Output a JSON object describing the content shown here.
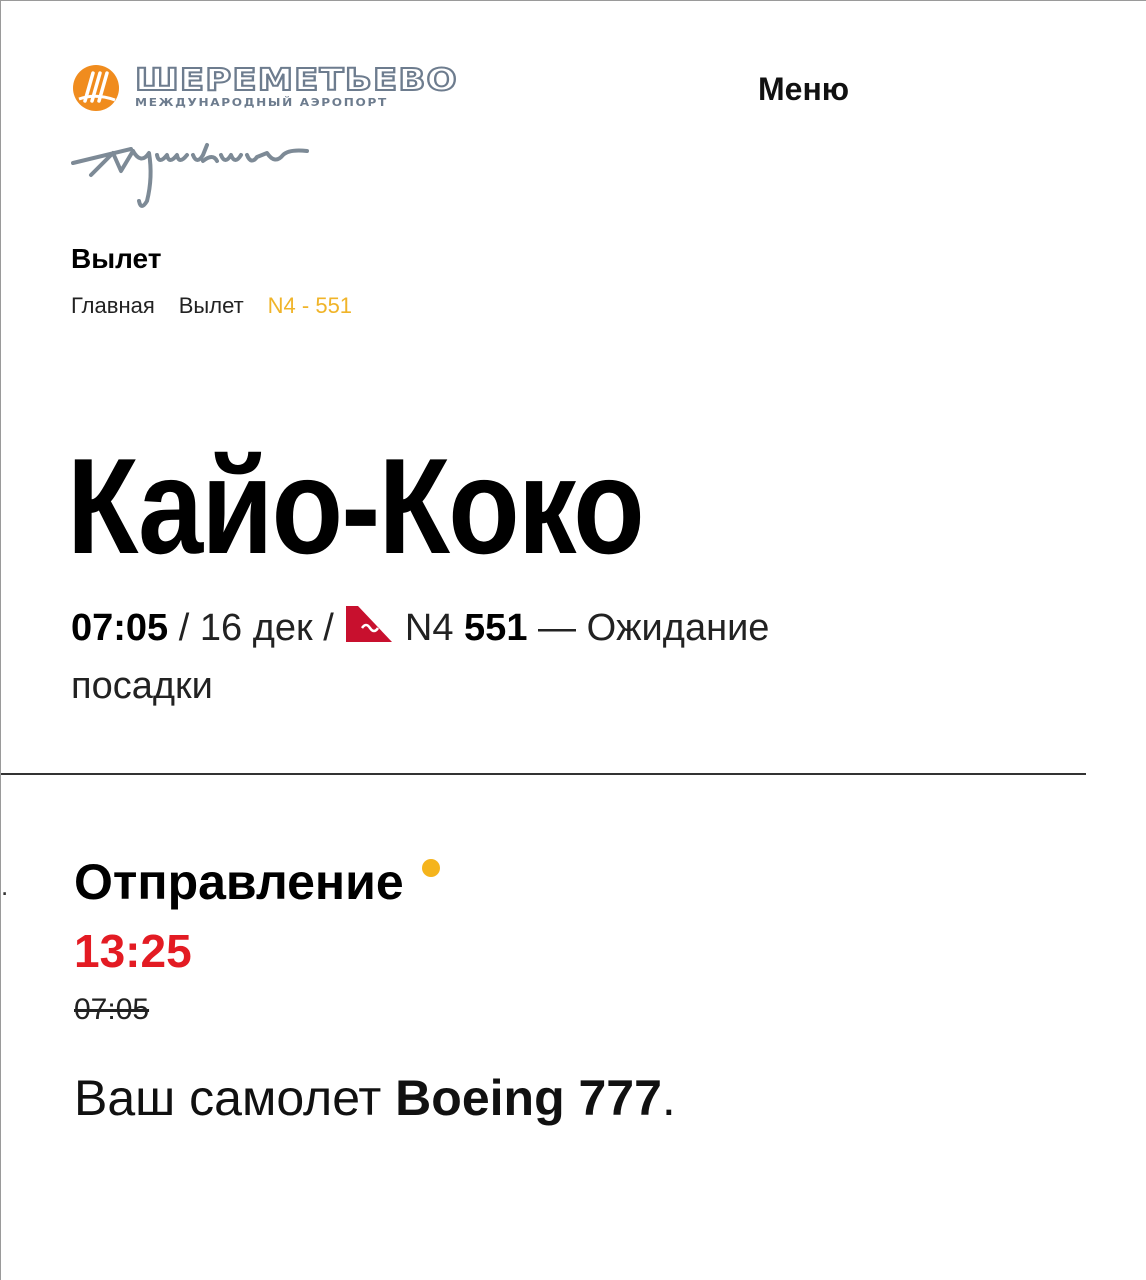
{
  "header": {
    "logo_name": "ШЕРЕМЕТЬЕВО",
    "logo_subtitle": "МЕЖДУНАРОДНЫЙ АЭРОПОРТ",
    "menu_label": "Меню"
  },
  "section_title": "Вылет",
  "breadcrumb": {
    "home": "Главная",
    "departures": "Вылет",
    "current": "N4 - 551"
  },
  "destination": "Кайо-Коко",
  "flight": {
    "time": "07:05",
    "sep1": " / ",
    "date": "16 дек",
    "sep2": " / ",
    "airline_code": "N4",
    "number": "551",
    "dash": " — ",
    "status": "Ожидание посадки"
  },
  "departure": {
    "title": "Отправление",
    "new_time": "13:25",
    "old_time": "07:05",
    "aircraft_prefix": "Ваш самолет ",
    "aircraft_model": "Boeing 777",
    "aircraft_suffix": "."
  },
  "colors": {
    "accent": "#f0b429",
    "delay_red": "#e31b23",
    "status_dot": "#f5b41c"
  }
}
